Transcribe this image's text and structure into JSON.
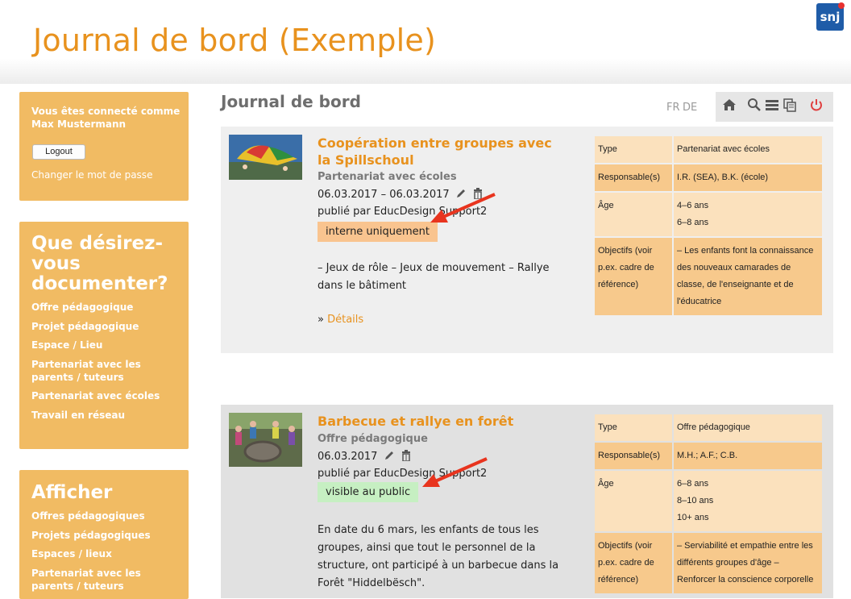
{
  "header": {
    "title": "Journal de bord (Exemple)",
    "logo_text": "snj"
  },
  "login": {
    "line1": "Vous êtes connecté comme",
    "user": "Max Mustermann",
    "logout": "Logout",
    "change_password": "Changer le mot de passe"
  },
  "document": {
    "heading": "Que désirez-vous documenter?",
    "items": [
      "Offre pédagogique",
      "Projet pédagogique",
      "Espace / Lieu",
      "Partenariat avec les parents / tuteurs",
      "Partenariat avec écoles",
      "Travail en réseau"
    ]
  },
  "display": {
    "heading": "Afficher",
    "items": [
      "Offres pédagogiques",
      "Projets pédagogiques",
      "Espaces / lieux",
      "Partenariat avec les parents / tuteurs"
    ]
  },
  "main": {
    "title": "Journal de bord",
    "lang": [
      "FR",
      "DE"
    ]
  },
  "toolbar": {
    "icons": [
      "home-icon",
      "search-icon",
      "list-icon",
      "copy-icon",
      "power-icon"
    ]
  },
  "entries": [
    {
      "title": "Coopération entre groupes avec la Spillschoul",
      "category": "Partenariat avec écoles",
      "date": "06.03.2017 – 06.03.2017",
      "published": "publié par EducDesign Support2",
      "status": "interne uniquement",
      "status_color": "#f9c48f",
      "description": "– Jeux de rôle – Jeux de mouvement – Rallye dans le bâtiment",
      "details_prefix": "» ",
      "details": "Détails",
      "info": {
        "type_label": "Type",
        "type_value": "Partenariat avec écoles",
        "resp_label": "Responsable(s)",
        "resp_value": "I.R. (SEA), B.K. (école)",
        "age_label": "Âge",
        "age_values": [
          "4–6 ans",
          "6–8 ans"
        ],
        "obj_label": "Objectifs (voir p.ex. cadre de référence)",
        "obj_value": "– Les enfants font la connaissance des nouveaux camarades de classe, de l'enseignante et de l'éducatrice"
      }
    },
    {
      "title": "Barbecue et rallye en forêt",
      "category": "Offre pédagogique",
      "date": "06.03.2017",
      "published": "publié par EducDesign Support2",
      "status": "visible au public",
      "status_color": "#c6efc2",
      "description": "En date du 6 mars, les enfants de tous les groupes, ainsi que tout le personnel de la structure, ont participé à un barbecue dans la Forêt \"Hiddelbësch\".",
      "info": {
        "type_label": "Type",
        "type_value": "Offre pédagogique",
        "resp_label": "Responsable(s)",
        "resp_value": "M.H.; A.F.; C.B.",
        "age_label": "Âge",
        "age_values": [
          "6–8 ans",
          "8–10 ans",
          "10+ ans"
        ],
        "obj_label": "Objectifs (voir p.ex. cadre de référence)",
        "obj_value": "– Serviabilité et empathie entre les différents groupes d'âge – Renforcer la conscience corporelle"
      }
    }
  ],
  "colors": {
    "accent": "#e8921e",
    "sidebar": "#f1bb63",
    "card1_bg": "#efefef",
    "card2_bg": "#e1e1e1",
    "arrow": "#e8341e"
  }
}
